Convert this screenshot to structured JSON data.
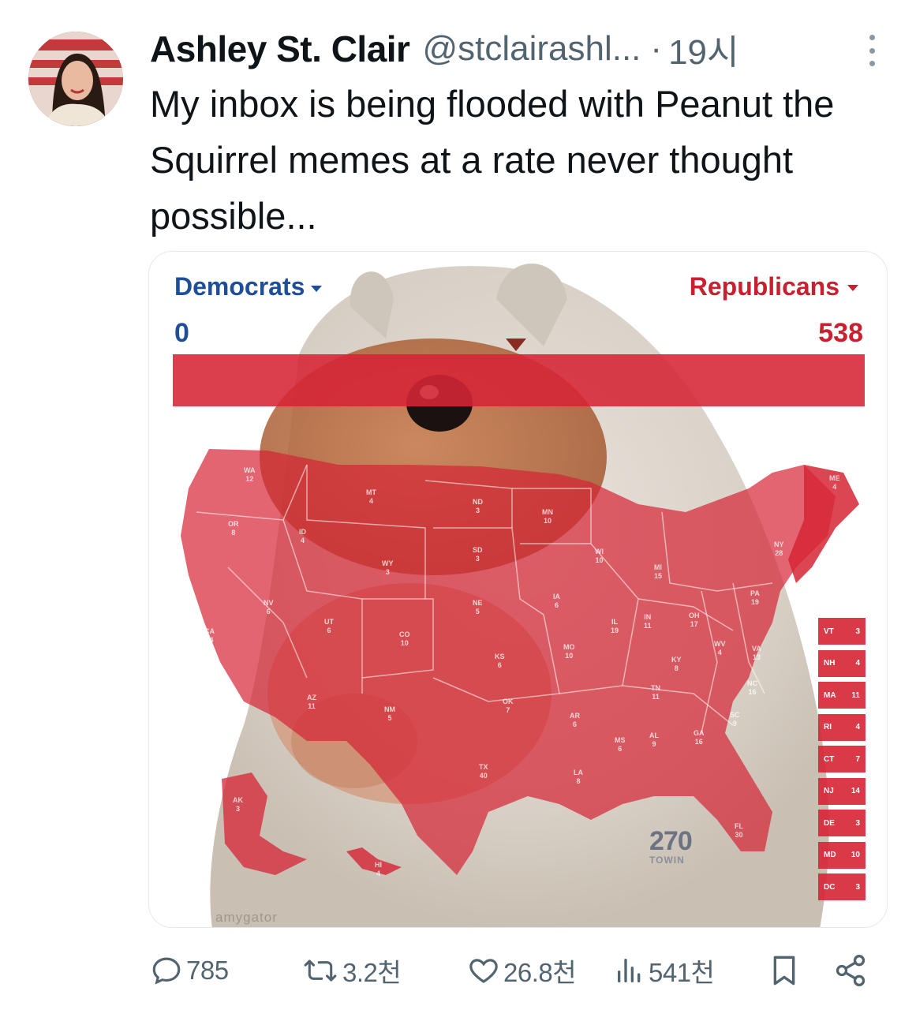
{
  "tweet": {
    "author_name": "Ashley St. Clair",
    "handle": "@stclairashl...",
    "separator": "·",
    "time": "19시",
    "text": "My inbox is being flooded with Peanut the Squirrel memes at a rate never thought possible..."
  },
  "media": {
    "dem_label": "Democrats",
    "dem_count": "0",
    "rep_label": "Republicans",
    "rep_count": "538",
    "logo": "270",
    "logo_sub": "TOWIN",
    "watermark": "amygator",
    "states": [
      {
        "abbr": "WA",
        "ev": "12"
      },
      {
        "abbr": "OR",
        "ev": "8"
      },
      {
        "abbr": "CA",
        "ev": "54"
      },
      {
        "abbr": "NV",
        "ev": "6"
      },
      {
        "abbr": "ID",
        "ev": "4"
      },
      {
        "abbr": "MT",
        "ev": "4"
      },
      {
        "abbr": "WY",
        "ev": "3"
      },
      {
        "abbr": "UT",
        "ev": "6"
      },
      {
        "abbr": "AZ",
        "ev": "11"
      },
      {
        "abbr": "CO",
        "ev": "10"
      },
      {
        "abbr": "NM",
        "ev": "5"
      },
      {
        "abbr": "ND",
        "ev": "3"
      },
      {
        "abbr": "SD",
        "ev": "3"
      },
      {
        "abbr": "NE",
        "ev": "5"
      },
      {
        "abbr": "KS",
        "ev": "6"
      },
      {
        "abbr": "OK",
        "ev": "7"
      },
      {
        "abbr": "TX",
        "ev": "40"
      },
      {
        "abbr": "MN",
        "ev": "10"
      },
      {
        "abbr": "IA",
        "ev": "6"
      },
      {
        "abbr": "MO",
        "ev": "10"
      },
      {
        "abbr": "AR",
        "ev": "6"
      },
      {
        "abbr": "LA",
        "ev": "8"
      },
      {
        "abbr": "WI",
        "ev": "10"
      },
      {
        "abbr": "IL",
        "ev": "19"
      },
      {
        "abbr": "MI",
        "ev": "15"
      },
      {
        "abbr": "IN",
        "ev": "11"
      },
      {
        "abbr": "OH",
        "ev": "17"
      },
      {
        "abbr": "KY",
        "ev": "8"
      },
      {
        "abbr": "TN",
        "ev": "11"
      },
      {
        "abbr": "MS",
        "ev": "6"
      },
      {
        "abbr": "AL",
        "ev": "9"
      },
      {
        "abbr": "GA",
        "ev": "16"
      },
      {
        "abbr": "FL",
        "ev": "30"
      },
      {
        "abbr": "SC",
        "ev": "9"
      },
      {
        "abbr": "NC",
        "ev": "16"
      },
      {
        "abbr": "VA",
        "ev": "13"
      },
      {
        "abbr": "WV",
        "ev": "4"
      },
      {
        "abbr": "PA",
        "ev": "19"
      },
      {
        "abbr": "NY",
        "ev": "28"
      },
      {
        "abbr": "ME",
        "ev": "4"
      },
      {
        "abbr": "AK",
        "ev": "3"
      },
      {
        "abbr": "HI",
        "ev": "4"
      }
    ],
    "small_states": [
      {
        "abbr": "VT",
        "ev": "3"
      },
      {
        "abbr": "NH",
        "ev": "4"
      },
      {
        "abbr": "MA",
        "ev": "11"
      },
      {
        "abbr": "RI",
        "ev": "4"
      },
      {
        "abbr": "CT",
        "ev": "7"
      },
      {
        "abbr": "NJ",
        "ev": "14"
      },
      {
        "abbr": "DE",
        "ev": "3"
      },
      {
        "abbr": "MD",
        "ev": "10"
      },
      {
        "abbr": "DC",
        "ev": "3"
      }
    ]
  },
  "actions": {
    "reply": {
      "icon": "reply-icon",
      "count": "785"
    },
    "repost": {
      "icon": "repost-icon",
      "count": "3.2천"
    },
    "like": {
      "icon": "heart-icon",
      "count": "26.8천"
    },
    "views": {
      "icon": "views-icon",
      "count": "541천"
    },
    "bookmark": {
      "icon": "bookmark-icon"
    },
    "share": {
      "icon": "share-icon"
    }
  },
  "colors": {
    "republican_red": "#d62434",
    "democrat_blue": "#1f4e99",
    "secondary_text": "#536471"
  }
}
